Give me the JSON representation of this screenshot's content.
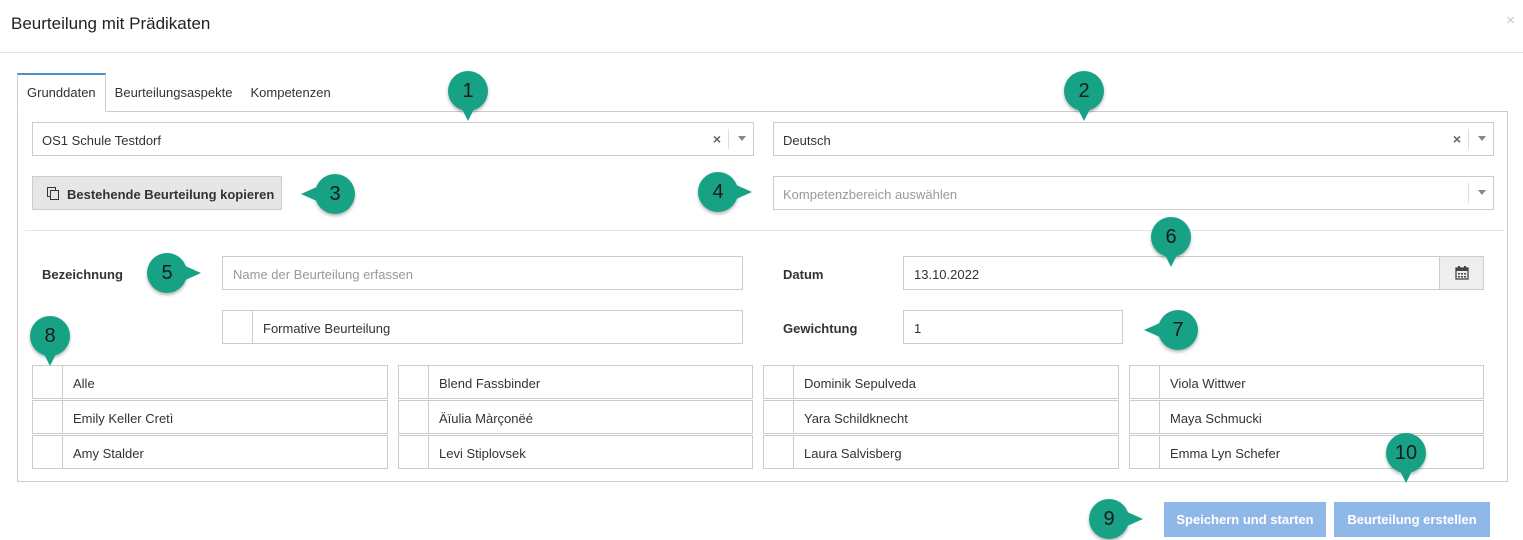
{
  "dialog": {
    "title": "Beurteilung mit Prädikaten",
    "close_glyph": "×"
  },
  "tabs": [
    {
      "label": "Grunddaten",
      "active": true
    },
    {
      "label": "Beurteilungsaspekte",
      "active": false
    },
    {
      "label": "Kompetenzen",
      "active": false
    }
  ],
  "school_select": {
    "value": "OS1 Schule Testdorf",
    "clear_glyph": "×"
  },
  "subject_select": {
    "value": "Deutsch",
    "clear_glyph": "×"
  },
  "copy_button": {
    "label": "Bestehende Beurteilung kopieren",
    "icon": "copy-icon"
  },
  "competence_select": {
    "placeholder": "Kompetenzbereich auswählen"
  },
  "bezeichnung": {
    "label": "Bezeichnung",
    "placeholder": "Name der Beurteilung erfassen"
  },
  "formative": {
    "label": "Formative Beurteilung"
  },
  "datum": {
    "label": "Datum",
    "value": "13.10.2022",
    "icon": "calendar-icon"
  },
  "gewichtung": {
    "label": "Gewichtung",
    "value": "1"
  },
  "students": [
    "Alle",
    "Blend Fassbinder",
    "Dominik Sepulveda",
    "Viola Wittwer",
    "Emily Keller Cretì",
    "Äïulia Màrçonëé",
    "Yara Schildknecht",
    "Maya Schmucki",
    "Amy Stalder",
    "Levi Stiplovsek",
    "Laura Salvisberg",
    "Emma Lyn Schefer"
  ],
  "buttons": {
    "save_start": "Speichern und starten",
    "create": "Beurteilung erstellen"
  },
  "markers": [
    "1",
    "2",
    "3",
    "4",
    "5",
    "6",
    "7",
    "8",
    "9",
    "10"
  ],
  "colors": {
    "accent_marker": "#17a285",
    "primary_button": "#8fb8e8",
    "tab_active_border": "#4a90c8"
  }
}
